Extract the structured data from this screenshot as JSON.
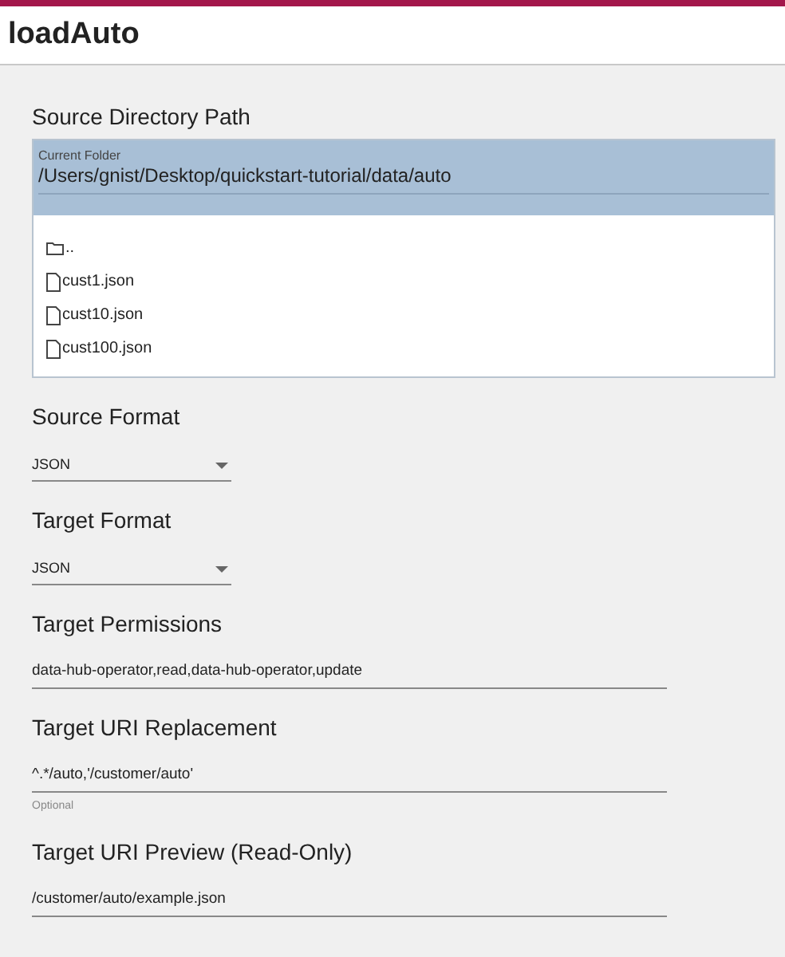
{
  "title": "loadAuto",
  "directory": {
    "label": "Source Directory Path",
    "current_folder_label": "Current Folder",
    "path": "/Users/gnist/Desktop/quickstart-tutorial/data/auto",
    "entries": [
      {
        "kind": "folder",
        "name": ".."
      },
      {
        "kind": "file",
        "name": "cust1.json"
      },
      {
        "kind": "file",
        "name": "cust10.json"
      },
      {
        "kind": "file",
        "name": "cust100.json"
      }
    ]
  },
  "fields": [
    {
      "kind": "select",
      "label": "Source Format",
      "value": "JSON"
    },
    {
      "kind": "select",
      "label": "Target Format",
      "value": "JSON"
    },
    {
      "kind": "text",
      "label": "Target Permissions",
      "value": "data-hub-operator,read,data-hub-operator,update"
    },
    {
      "kind": "text",
      "label": "Target URI Replacement",
      "value": "^.*/auto,'/customer/auto'",
      "helper": "Optional"
    },
    {
      "kind": "text",
      "label": "Target URI Preview (Read-Only)",
      "value": "/customer/auto/example.json"
    }
  ]
}
